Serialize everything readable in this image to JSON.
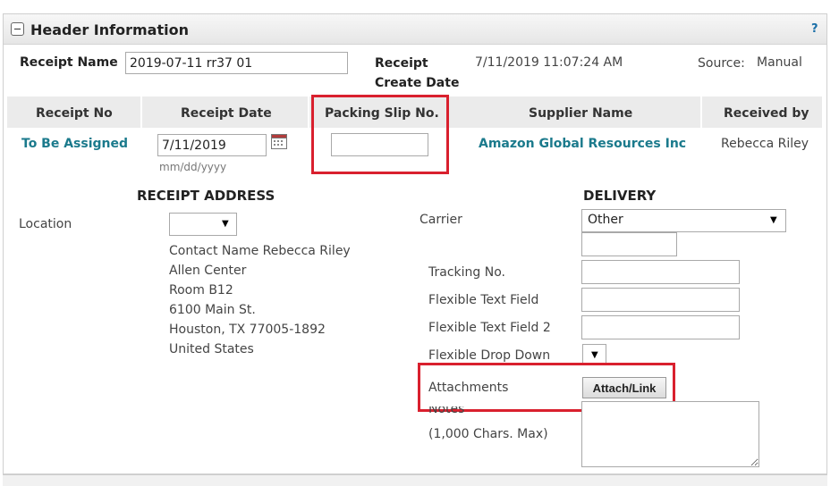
{
  "header": {
    "title": "Header Information",
    "help": "?"
  },
  "top": {
    "receipt_name_label": "Receipt Name",
    "receipt_name_value": "2019-07-11 rr37 01",
    "receipt_create_date_label_1": "Receipt",
    "receipt_create_date_label_2": "Create Date",
    "receipt_create_date_value": "7/11/2019 11:07:24 AM",
    "source_label": "Source:",
    "source_value": "Manual"
  },
  "columns": {
    "receipt_no": "Receipt No",
    "receipt_date": "Receipt Date",
    "packing_slip": "Packing Slip No.",
    "supplier_name": "Supplier Name",
    "received_by": "Received by"
  },
  "row": {
    "receipt_no": "To Be Assigned",
    "receipt_date": "7/11/2019",
    "date_format": "mm/dd/yyyy",
    "packing_slip": "",
    "supplier_name": "Amazon Global Resources Inc",
    "received_by": "Rebecca Riley"
  },
  "receipt_address": {
    "heading": "RECEIPT ADDRESS",
    "location_label": "Location",
    "location_value": "",
    "lines": [
      "Contact Name Rebecca Riley",
      "Allen Center",
      "Room B12",
      "6100 Main St.",
      "Houston, TX 77005-1892",
      "United States"
    ]
  },
  "delivery": {
    "heading": "DELIVERY",
    "carrier_label": "Carrier",
    "carrier_value": "Other",
    "carrier_other": "",
    "tracking_label": "Tracking No.",
    "tracking_value": "",
    "flex1_label": "Flexible Text Field",
    "flex1_value": "",
    "flex2_label": "Flexible Text Field 2",
    "flex2_value": "",
    "flexdrop_label": "Flexible Drop Down",
    "flexdrop_value": "",
    "attachments_label": "Attachments",
    "attach_button": "Attach/Link",
    "notes_label": "Notes",
    "notes_hint": "(1,000 Chars. Max)",
    "notes_value": ""
  },
  "colors": {
    "highlight": "#d9202e",
    "link": "#1b7a8c"
  }
}
